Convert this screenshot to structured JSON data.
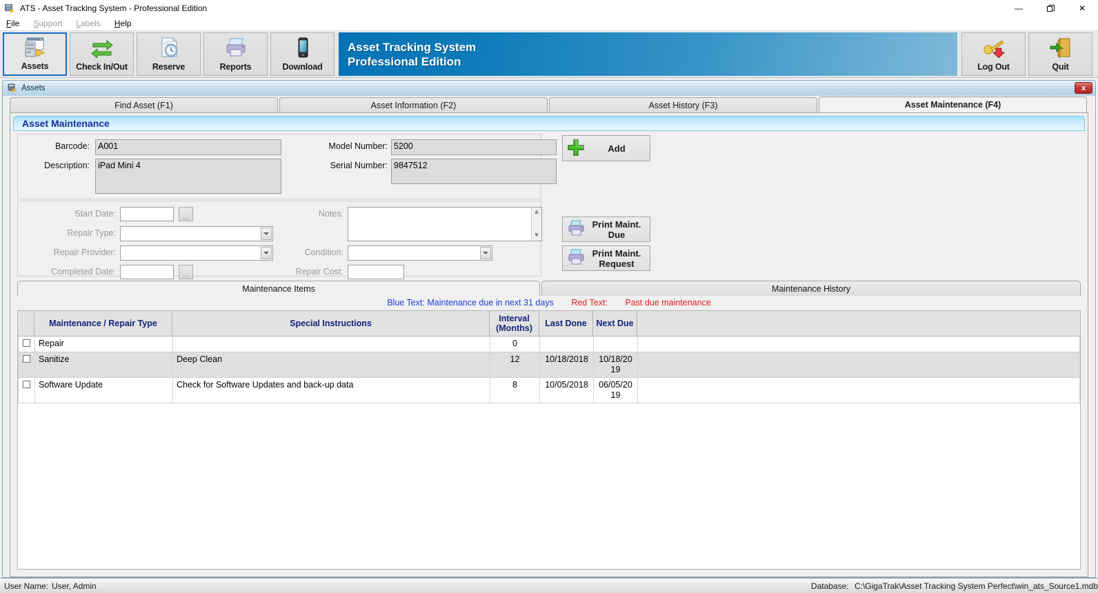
{
  "window": {
    "title": "ATS - Asset Tracking System - Professional Edition",
    "icon": "app-icon",
    "minimize": "—",
    "restore": "❐",
    "close": "✕"
  },
  "menubar": [
    {
      "label": "File",
      "disabled": false
    },
    {
      "label": "Support",
      "disabled": true
    },
    {
      "label": "Labels",
      "disabled": true
    },
    {
      "label": "Help",
      "disabled": false
    }
  ],
  "toolbar": {
    "left_buttons": [
      {
        "label": "Assets",
        "icon": "assets-icon",
        "selected": true
      },
      {
        "label": "Check In/Out",
        "icon": "check-in-out-icon",
        "selected": false
      },
      {
        "label": "Reserve",
        "icon": "reserve-icon",
        "selected": false
      },
      {
        "label": "Reports",
        "icon": "reports-icon",
        "selected": false
      },
      {
        "label": "Download",
        "icon": "download-icon",
        "selected": false
      }
    ],
    "brand_line1": "Asset Tracking System",
    "brand_line2": "Professional Edition",
    "right_buttons": [
      {
        "label": "Log Out",
        "icon": "log-out-icon"
      },
      {
        "label": "Quit",
        "icon": "quit-icon"
      }
    ]
  },
  "mdi": {
    "title": "Assets",
    "close_label": "x"
  },
  "tabs": [
    {
      "label": "Find Asset (F1)",
      "active": false
    },
    {
      "label": "Asset Information (F2)",
      "active": false
    },
    {
      "label": "Asset History (F3)",
      "active": false
    },
    {
      "label": "Asset Maintenance (F4)",
      "active": true
    }
  ],
  "pane": {
    "header": "Asset Maintenance"
  },
  "asset_fields": {
    "barcode_label": "Barcode:",
    "barcode_value": "A001",
    "description_label": "Description:",
    "description_value": "iPad Mini 4",
    "model_label": "Model Number:",
    "model_value": "5200",
    "serial_label": "Serial Number:",
    "serial_value": "9847512"
  },
  "repair_fields": {
    "start_date_label": "Start Date:",
    "start_date_value": "",
    "repair_type_label": "Repair Type:",
    "repair_type_value": "",
    "repair_provider_label": "Repair Provider:",
    "repair_provider_value": "",
    "completed_date_label": "Completed Date:",
    "completed_date_value": "",
    "notes_label": "Notes:",
    "notes_value": "",
    "condition_label": "Condition:",
    "condition_value": "",
    "repair_cost_label": "Repair Cost:",
    "repair_cost_value": "",
    "browse_label": "..."
  },
  "actions": {
    "add_label": "Add",
    "print_due_line1": "Print Maint.",
    "print_due_line2": "Due",
    "print_request_line1": "Print Maint.",
    "print_request_line2": "Request"
  },
  "maintenance": {
    "tab_items": "Maintenance Items",
    "tab_history": "Maintenance History",
    "legend_blue_key": "Blue Text:",
    "legend_blue": "Maintenance due in next 31 days",
    "legend_red_key": "Red Text:",
    "legend_red": "Past due maintenance",
    "columns": [
      "",
      "Maintenance / Repair Type",
      "Special Instructions",
      "Interval\n(Months)",
      "Last Done",
      "Next Due",
      ""
    ],
    "col_interval_line1": "Interval",
    "col_interval_line2": "(Months)",
    "rows": [
      {
        "type": "Repair",
        "instructions": "",
        "interval": "0",
        "last_done": "",
        "next_due": ""
      },
      {
        "type": "Sanitize",
        "instructions": "Deep Clean",
        "interval": "12",
        "last_done": "10/18/2018",
        "next_due": "10/18/2019"
      },
      {
        "type": "Software Update",
        "instructions": "Check for Software Updates and back-up data",
        "interval": "8",
        "last_done": "10/05/2018",
        "next_due": "06/05/2019"
      }
    ]
  },
  "statusbar": {
    "user_label": "User Name:",
    "user_value": "User, Admin",
    "db_label": "Database:",
    "db_value": "C:\\GigaTrak\\Asset Tracking System Perfect\\win_ats_Source1.mdb"
  },
  "colors": {
    "brand_blue": "#0273b5",
    "header_text_blue": "#12309b",
    "legend_blue": "#1b3fd0",
    "legend_red": "#e02020",
    "selection_border": "#1569c7"
  }
}
